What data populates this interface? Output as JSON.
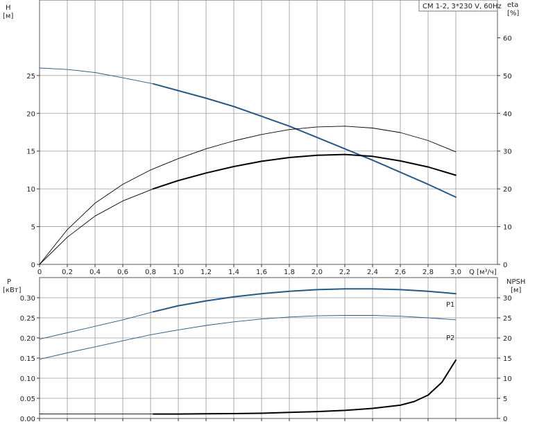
{
  "chart_data": [
    {
      "type": "line",
      "panel": "head-efficiency",
      "legend_label": "CM 1-2, 3*230 V, 60Hz",
      "legend_position": "top-right",
      "grid": true,
      "x": {
        "unit_label": "Q [м³/ч]",
        "range": [
          0,
          3.3
        ],
        "ticks": [
          0,
          0.2,
          0.4,
          0.6,
          0.8,
          1.0,
          1.2,
          1.4,
          1.6,
          1.8,
          2.0,
          2.2,
          2.4,
          2.6,
          2.8,
          3.0
        ],
        "tick_labels": [
          "0",
          "0,2",
          "0,4",
          "0,6",
          "0,8",
          "1,0",
          "1,2",
          "1,4",
          "1,6",
          "1,8",
          "2,0",
          "2,2",
          "2,4",
          "2,6",
          "2,8",
          "3,0"
        ]
      },
      "y_left": {
        "label": "H",
        "unit": "[м]",
        "range": [
          0,
          35
        ],
        "ticks": [
          0,
          5,
          10,
          15,
          20,
          25
        ],
        "tick_labels": [
          "0",
          "5",
          "10",
          "15",
          "20",
          "25"
        ]
      },
      "y_right": {
        "label": "eta",
        "unit": "[%]",
        "range": [
          0,
          70
        ],
        "ticks": [
          0,
          10,
          20,
          30,
          40,
          50,
          60
        ],
        "tick_labels": [
          "0",
          "10",
          "20",
          "30",
          "40",
          "50",
          "60"
        ]
      },
      "series": [
        {
          "axis": "left",
          "color": "#1f5a96",
          "highlight_from": 0.82,
          "points": [
            [
              0,
              26.0
            ],
            [
              0.2,
              25.8
            ],
            [
              0.4,
              25.4
            ],
            [
              0.6,
              24.7
            ],
            [
              0.82,
              23.9
            ],
            [
              1.0,
              23.0
            ],
            [
              1.2,
              22.0
            ],
            [
              1.4,
              20.9
            ],
            [
              1.6,
              19.6
            ],
            [
              1.8,
              18.3
            ],
            [
              2.0,
              16.8
            ],
            [
              2.2,
              15.3
            ],
            [
              2.4,
              13.8
            ],
            [
              2.6,
              12.2
            ],
            [
              2.8,
              10.6
            ],
            [
              3.0,
              8.9
            ]
          ]
        },
        {
          "axis": "right",
          "color": "#000000",
          "highlight_from": 0.82,
          "points": [
            [
              0,
              0
            ],
            [
              0.2,
              7.2
            ],
            [
              0.4,
              12.8
            ],
            [
              0.6,
              16.8
            ],
            [
              0.82,
              20.0
            ],
            [
              1.0,
              22.2
            ],
            [
              1.2,
              24.2
            ],
            [
              1.4,
              25.9
            ],
            [
              1.6,
              27.3
            ],
            [
              1.8,
              28.3
            ],
            [
              2.0,
              28.9
            ],
            [
              2.2,
              29.1
            ],
            [
              2.4,
              28.6
            ],
            [
              2.6,
              27.4
            ],
            [
              2.8,
              25.8
            ],
            [
              3.0,
              23.6
            ]
          ]
        },
        {
          "axis": "right",
          "color": "#000000",
          "highlight_from": null,
          "points": [
            [
              0,
              0
            ],
            [
              0.2,
              9.2
            ],
            [
              0.4,
              16.2
            ],
            [
              0.6,
              21.2
            ],
            [
              0.8,
              25.0
            ],
            [
              1.0,
              28.0
            ],
            [
              1.2,
              30.6
            ],
            [
              1.4,
              32.7
            ],
            [
              1.6,
              34.4
            ],
            [
              1.8,
              35.7
            ],
            [
              2.0,
              36.4
            ],
            [
              2.2,
              36.6
            ],
            [
              2.4,
              36.1
            ],
            [
              2.6,
              34.9
            ],
            [
              2.8,
              32.8
            ],
            [
              3.0,
              29.8
            ]
          ]
        }
      ]
    },
    {
      "type": "line",
      "panel": "power-npsh",
      "grid": true,
      "x": {
        "range": [
          0,
          3.3
        ],
        "ticks": [
          0,
          0.2,
          0.4,
          0.6,
          0.8,
          1.0,
          1.2,
          1.4,
          1.6,
          1.8,
          2.0,
          2.2,
          2.4,
          2.6,
          2.8,
          3.0
        ]
      },
      "y_left": {
        "label": "P",
        "unit": "[кВт]",
        "range": [
          0,
          0.35
        ],
        "ticks": [
          0,
          0.05,
          0.1,
          0.15,
          0.2,
          0.25,
          0.3
        ],
        "tick_labels": [
          "0.00",
          "0.05",
          "0.10",
          "0.15",
          "0.20",
          "0.25",
          "0.30"
        ]
      },
      "y_right": {
        "label": "NPSH",
        "unit": "[м]",
        "range": [
          0,
          35
        ],
        "ticks": [
          0,
          5,
          10,
          15,
          20,
          25,
          30
        ],
        "tick_labels": [
          "0",
          "5",
          "10",
          "15",
          "20",
          "25",
          "30"
        ]
      },
      "series": [
        {
          "name": "P1",
          "axis": "left",
          "color": "#1f5a96",
          "highlight_from": 0.82,
          "points": [
            [
              0,
              0.197
            ],
            [
              0.2,
              0.213
            ],
            [
              0.4,
              0.229
            ],
            [
              0.6,
              0.245
            ],
            [
              0.82,
              0.265
            ],
            [
              1.0,
              0.28
            ],
            [
              1.2,
              0.292
            ],
            [
              1.4,
              0.302
            ],
            [
              1.6,
              0.31
            ],
            [
              1.8,
              0.316
            ],
            [
              2.0,
              0.32
            ],
            [
              2.2,
              0.322
            ],
            [
              2.4,
              0.322
            ],
            [
              2.6,
              0.32
            ],
            [
              2.8,
              0.316
            ],
            [
              3.0,
              0.31
            ]
          ]
        },
        {
          "name": "P2",
          "axis": "left",
          "color": "#1f5a96",
          "highlight_from": null,
          "points": [
            [
              0,
              0.147
            ],
            [
              0.2,
              0.163
            ],
            [
              0.4,
              0.178
            ],
            [
              0.6,
              0.193
            ],
            [
              0.8,
              0.208
            ],
            [
              1.0,
              0.22
            ],
            [
              1.2,
              0.231
            ],
            [
              1.4,
              0.24
            ],
            [
              1.6,
              0.247
            ],
            [
              1.8,
              0.252
            ],
            [
              2.0,
              0.255
            ],
            [
              2.2,
              0.256
            ],
            [
              2.4,
              0.256
            ],
            [
              2.6,
              0.254
            ],
            [
              2.8,
              0.25
            ],
            [
              3.0,
              0.245
            ]
          ]
        },
        {
          "axis": "right",
          "color": "#000000",
          "highlight_from": 0.82,
          "points": [
            [
              0,
              1.1
            ],
            [
              0.82,
              1.1
            ],
            [
              1.0,
              1.1
            ],
            [
              1.2,
              1.15
            ],
            [
              1.4,
              1.2
            ],
            [
              1.6,
              1.3
            ],
            [
              1.8,
              1.5
            ],
            [
              2.0,
              1.7
            ],
            [
              2.2,
              2.0
            ],
            [
              2.4,
              2.5
            ],
            [
              2.6,
              3.3
            ],
            [
              2.7,
              4.2
            ],
            [
              2.8,
              5.8
            ],
            [
              2.9,
              9.0
            ],
            [
              3.0,
              14.5
            ]
          ]
        }
      ]
    }
  ]
}
